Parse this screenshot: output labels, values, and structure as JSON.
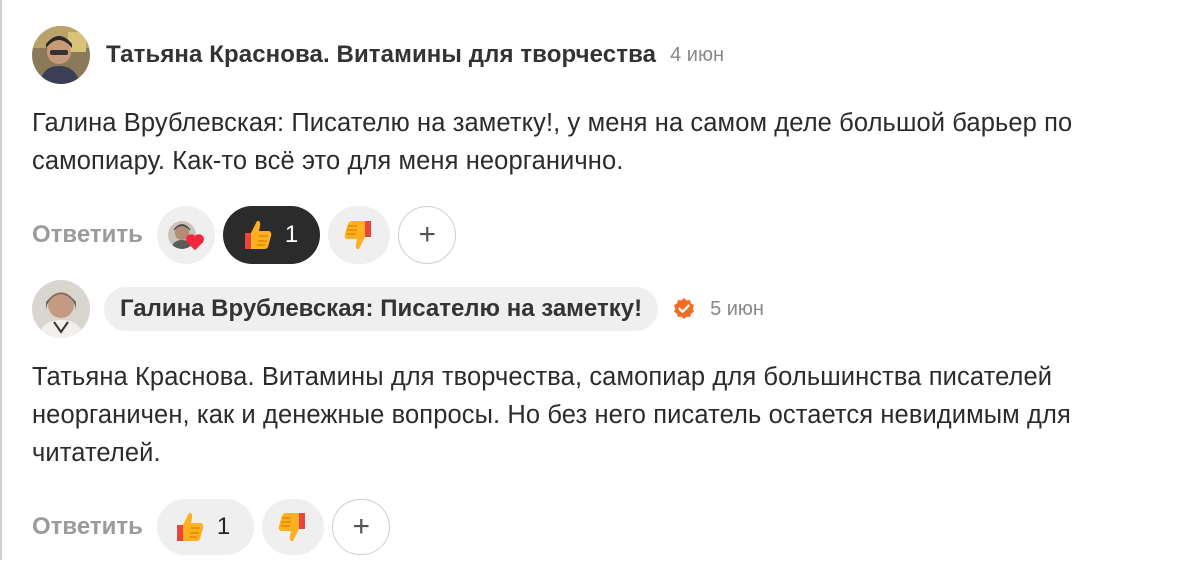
{
  "comments": [
    {
      "author": "Татьяна Краснова. Витамины для творчества",
      "date": "4 июн",
      "avatar_icon": "user-photo-avatar",
      "text": "Галина Врублевская: Писателю на заметку!, у меня на самом деле большой барьер по самопиару. Как-то всё это для меня неорганично.",
      "actions": {
        "reply_label": "Ответить",
        "reaction_avatar_icon": "user-heart-reaction-icon",
        "like_count": "1",
        "like_active": true,
        "like_icon": "thumbs-up-icon",
        "dislike_icon": "thumbs-down-icon",
        "add_label": "+"
      }
    },
    {
      "author": "Галина Врублевская: Писателю на заметку!",
      "verified": true,
      "date": "5 июн",
      "avatar_icon": "user-photo-avatar",
      "text": "Татьяна Краснова. Витамины для творчества, самопиар для большинства писателей неорганичен, как и денежные вопросы. Но без него писатель остается невидимым для читателей.",
      "actions": {
        "reply_label": "Ответить",
        "like_count": "1",
        "like_active": false,
        "like_icon": "thumbs-up-icon",
        "dislike_icon": "thumbs-down-icon",
        "add_label": "+"
      }
    }
  ],
  "colors": {
    "verified_badge": "#f26b1f",
    "active_reaction_bg": "#2b2b2b",
    "reaction_bg": "#efefef",
    "muted_text": "#9b9b9b"
  }
}
